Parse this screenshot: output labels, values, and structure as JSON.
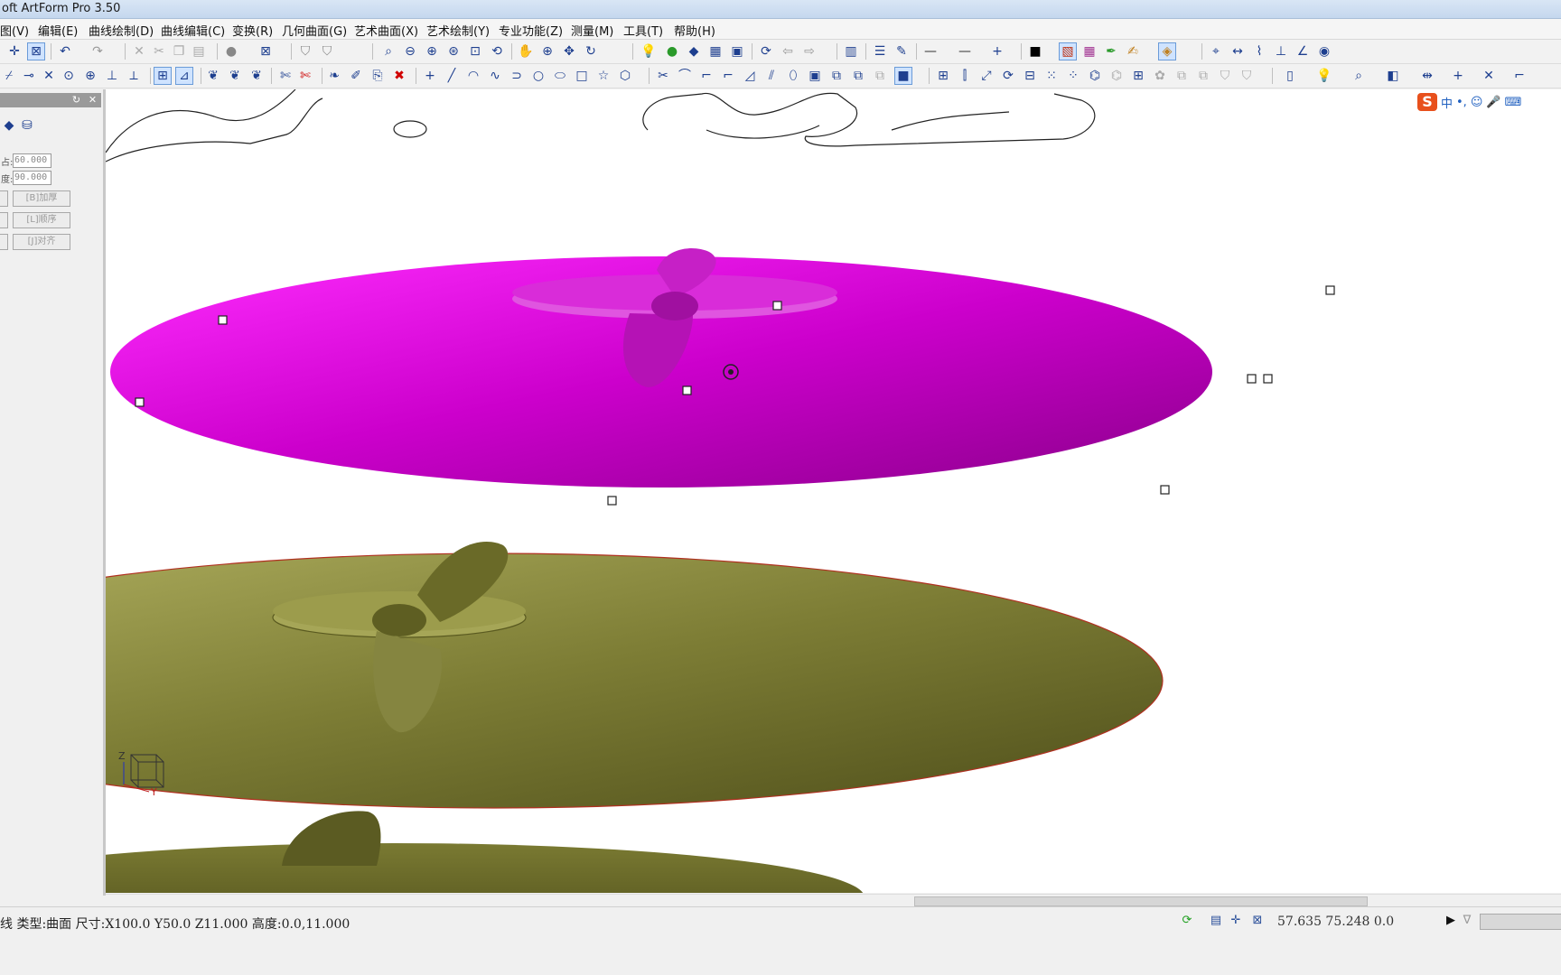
{
  "window": {
    "title": "oft ArtForm Pro 3.50"
  },
  "menu": [
    "图(V)",
    "编辑(E)",
    "曲线绘制(D)",
    "曲线编辑(C)",
    "变换(R)",
    "几何曲面(G)",
    "艺术曲面(X)",
    "艺术绘制(Y)",
    "专业功能(Z)",
    "测量(M)",
    "工具(T)",
    "帮助(H)"
  ],
  "panel": {
    "field1_label": "占:",
    "field1_value": "60.000",
    "field2_label": "度:",
    "field2_value": "90.000",
    "btn1": "[B]加厚",
    "btn2": "[L]顺序",
    "btn3": "[J]对齐"
  },
  "status": {
    "text": "线 类型:曲面 尺寸:X100.0 Y50.0 Z11.000 高度:0.0,11.000",
    "coords": "57.635 75.248 0.0"
  },
  "ime": {
    "logo": "S",
    "lang": "中"
  },
  "colors": {
    "selected_surface": "#d400d4",
    "olive_surface": "#8a8a3a",
    "accent": "#1e3f8f"
  },
  "icons": [
    "pan-icon",
    "zoom-in-icon",
    "zoom-out-icon",
    "rotate-icon",
    "undo-icon",
    "redo-icon",
    "cut-icon",
    "copy-icon",
    "paste-icon",
    "line-icon",
    "arc-icon",
    "circle-icon",
    "rectangle-icon",
    "star-icon",
    "polygon-icon",
    "delete-icon",
    "light-icon",
    "color-icon"
  ]
}
